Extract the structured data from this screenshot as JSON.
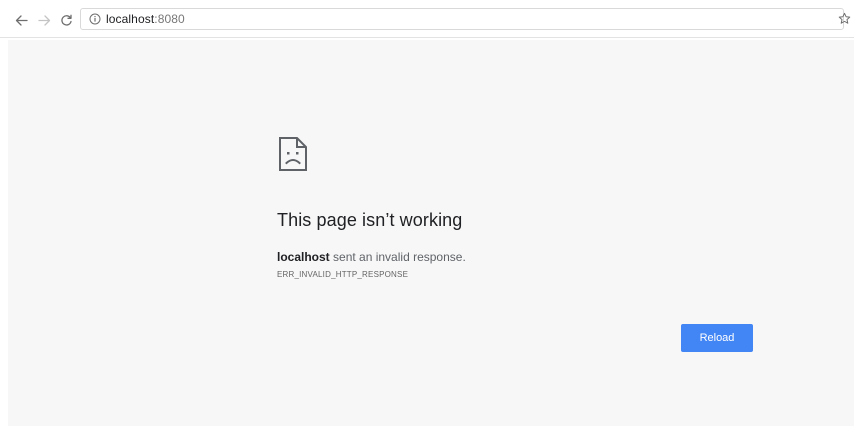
{
  "toolbar": {
    "url_host": "localhost",
    "url_port": ":8080",
    "icons": {
      "back": "arrow-left-icon",
      "forward": "arrow-right-icon",
      "reload": "reload-icon",
      "info": "info-icon",
      "bookmark": "star-icon"
    }
  },
  "error_page": {
    "title": "This page isn’t working",
    "host": "localhost",
    "message_suffix": " sent an invalid response.",
    "error_code": "ERR_INVALID_HTTP_RESPONSE",
    "reload_label": "Reload",
    "icon": "sad-page-icon"
  },
  "colors": {
    "accent": "#4285f4",
    "content_bg": "#f7f7f7"
  }
}
